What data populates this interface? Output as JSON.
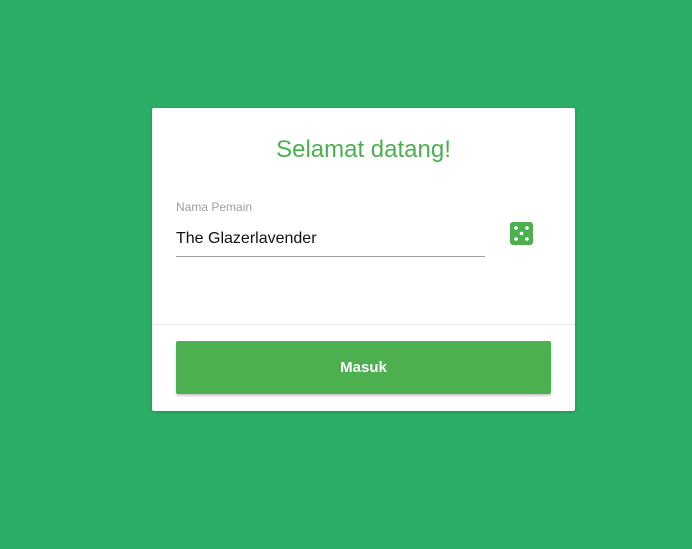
{
  "card": {
    "title": "Selamat datang!",
    "name_field": {
      "label": "Nama Pemain",
      "value": "The Glazerlavender"
    },
    "random_icon": "dice-icon",
    "submit_label": "Masuk"
  },
  "colors": {
    "background": "#2bae66",
    "accent": "#4caf50"
  }
}
